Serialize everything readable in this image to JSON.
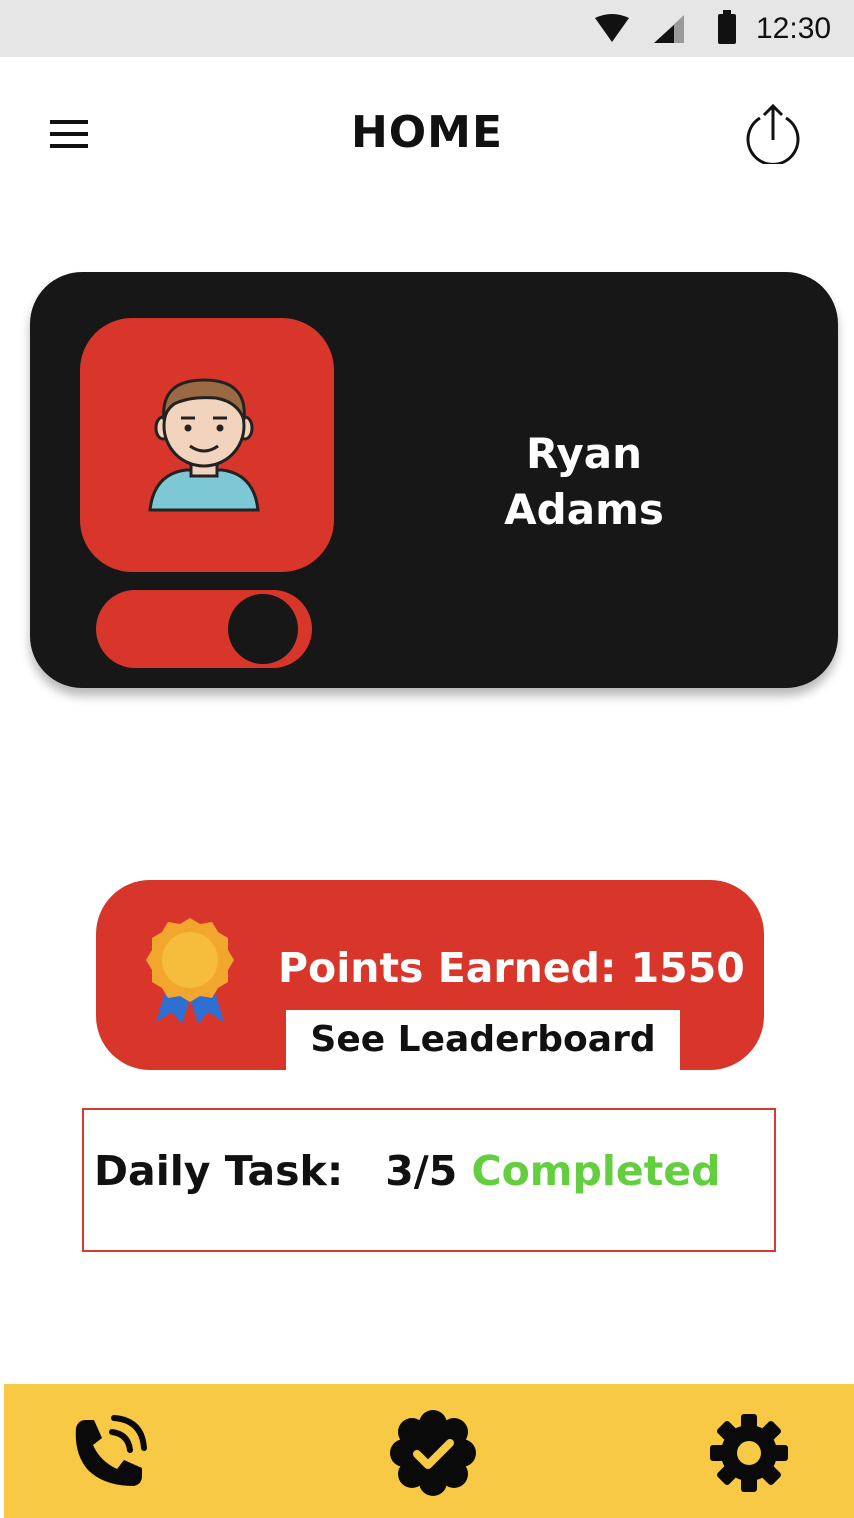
{
  "status_bar": {
    "time": "12:30",
    "icons": [
      "wifi-icon",
      "signal-icon",
      "battery-icon"
    ]
  },
  "app_bar": {
    "title": "HOME",
    "left_icon": "menu-icon",
    "right_icon": "export-icon"
  },
  "profile": {
    "first_name": "Ryan",
    "last_name": "Adams",
    "avatar_icon": "avatar-icon",
    "toggle_on": true
  },
  "points": {
    "text": "Points Earned: 1550",
    "leaderboard_label": "See Leaderboard",
    "icon": "medal-icon"
  },
  "daily_task": {
    "label": "Daily Task:",
    "progress": "3/5",
    "status": "Completed"
  },
  "bottom_nav": {
    "items": [
      {
        "name": "calls",
        "icon": "phone-call-icon"
      },
      {
        "name": "tasks",
        "icon": "verified-check-icon"
      },
      {
        "name": "settings",
        "icon": "gear-icon"
      }
    ]
  },
  "colors": {
    "accent_red": "#d8362b",
    "card_dark": "#171717",
    "nav_yellow": "#f8c945",
    "success_green": "#63cf3f"
  }
}
